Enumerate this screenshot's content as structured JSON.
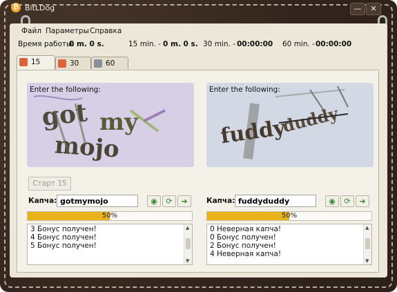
{
  "app": {
    "title": "BitLDog",
    "icon": "bitcoin-icon",
    "window_buttons": {
      "minimize": "—",
      "close": "✕"
    }
  },
  "menu": [
    "Файл",
    "Параметры",
    "Справка"
  ],
  "stats": {
    "uptime_label": "Время работы:",
    "uptime_value": "0 m. 0 s.",
    "timers": [
      {
        "label": "15 min. -",
        "value": "0 m. 0 s."
      },
      {
        "label": "30 min. -",
        "value": "00:00:00"
      },
      {
        "label": "60 min. -",
        "value": "00:00:00"
      }
    ]
  },
  "tabs": [
    {
      "label": "15 min",
      "active": true
    },
    {
      "label": "30 min",
      "active": false
    },
    {
      "label": "60 min",
      "active": false
    }
  ],
  "captchas": [
    {
      "prompt": "Enter the following:",
      "input_label": "Капча:",
      "input_value": "gotmymojo",
      "progress_text": "50%",
      "progress": 0.5,
      "log": [
        "3 Бонус получен!",
        "4 Бонус получен!",
        "5 Бонус получен!"
      ]
    },
    {
      "prompt": "Enter the following:",
      "input_label": "Капча:",
      "input_value": "fuddyduddy",
      "progress_text": "50%",
      "progress": 0.5,
      "log": [
        "0 Неверная капча!",
        "0 Бонус получен!",
        "2 Бонус получен!",
        "4 Неверная капча!"
      ]
    }
  ],
  "start_button": "Старт 15",
  "colors": {
    "progress": "#e9b21a",
    "accent": "#f5a623",
    "frame": "#3a2b22",
    "panel": "#ece7d8"
  }
}
